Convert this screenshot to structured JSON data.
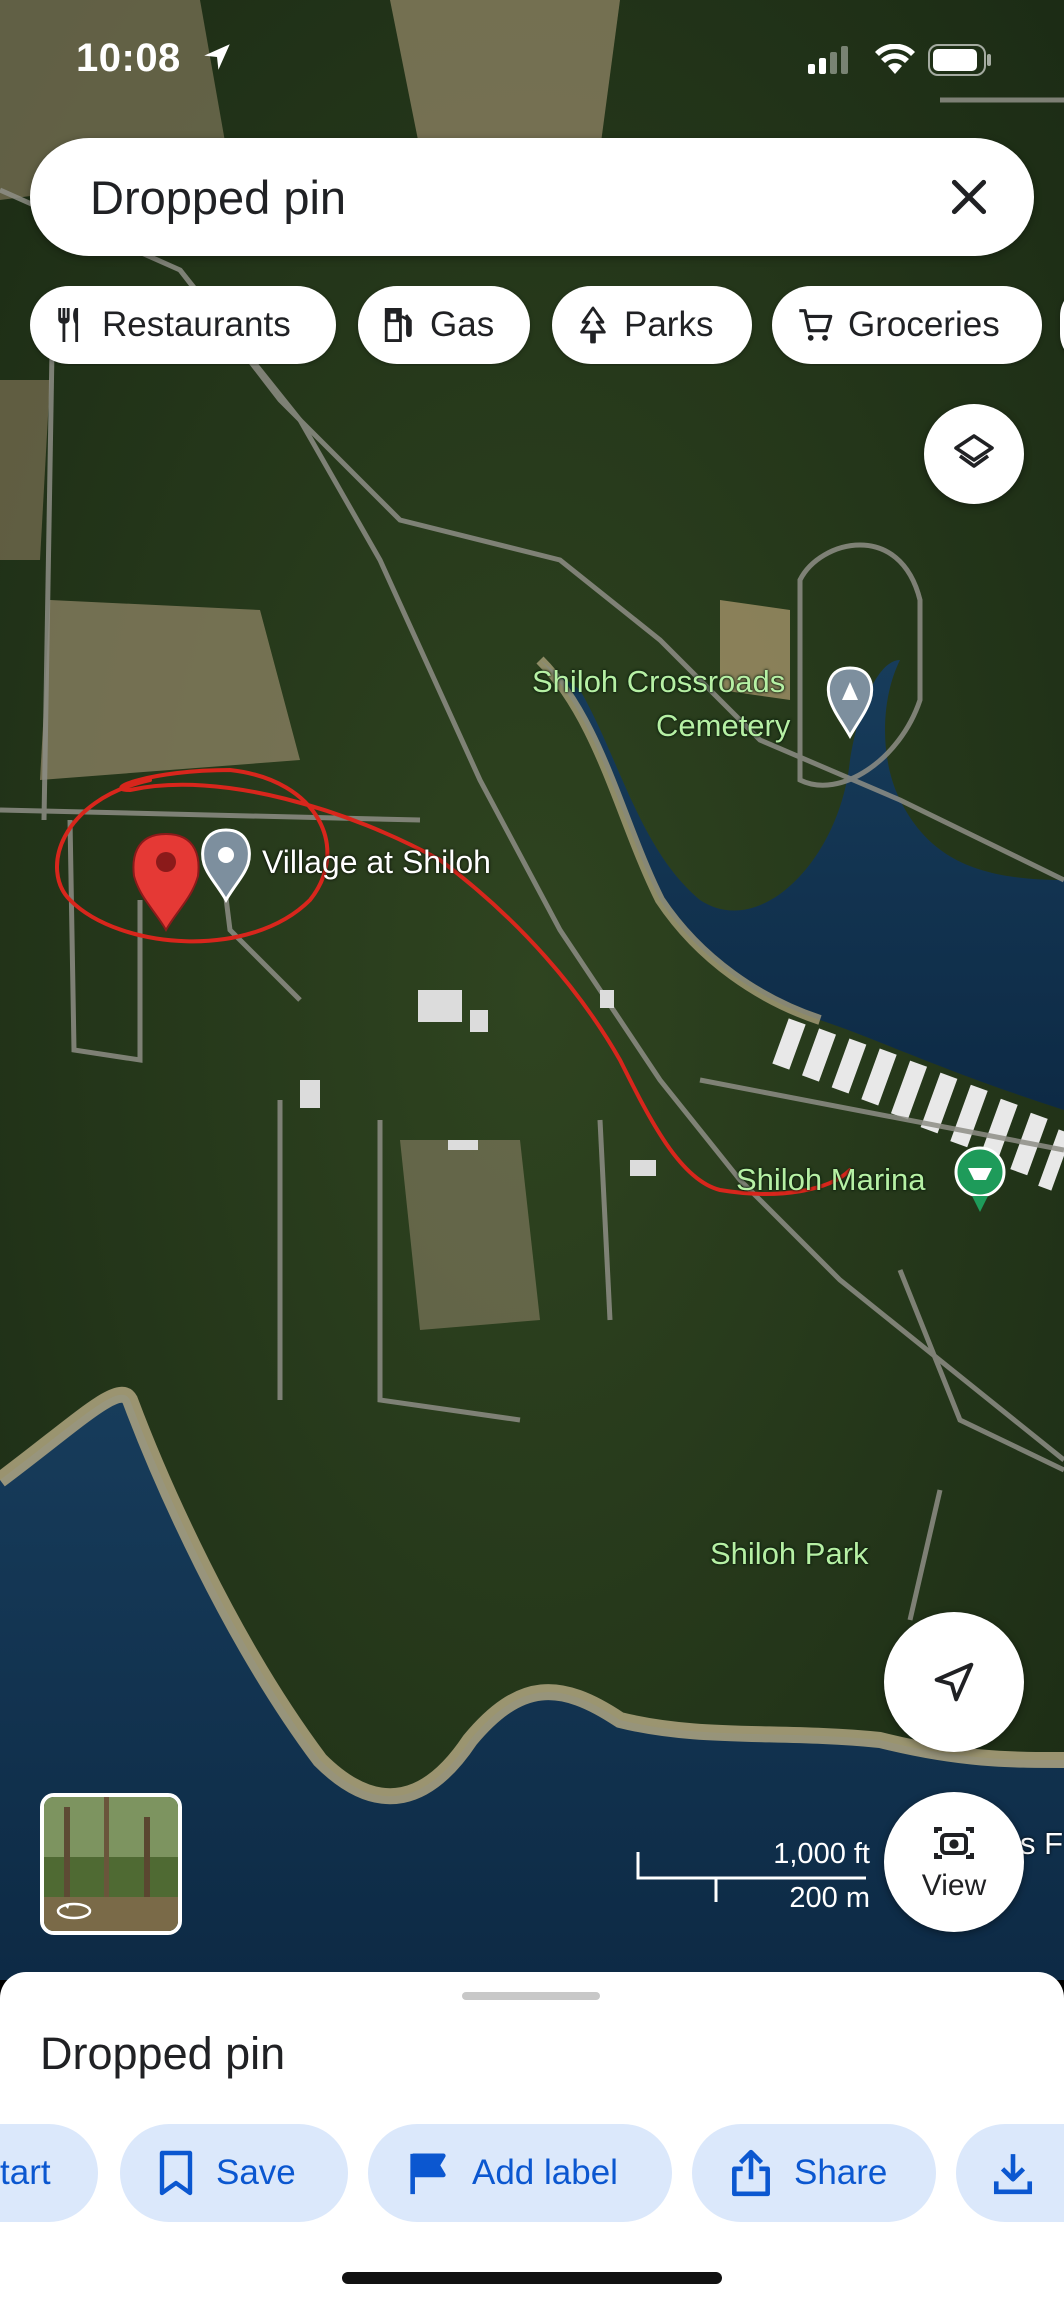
{
  "status_bar": {
    "time": "10:08",
    "icons": [
      "location-arrow-icon",
      "signal-icon",
      "wifi-icon",
      "battery-icon"
    ]
  },
  "search": {
    "query": "Dropped pin",
    "icon": "close-icon"
  },
  "chips": [
    {
      "label": "Restaurants",
      "icon": "fork-knife-icon"
    },
    {
      "label": "Gas",
      "icon": "gas-pump-icon"
    },
    {
      "label": "Parks",
      "icon": "tree-icon"
    },
    {
      "label": "Groceries",
      "icon": "cart-icon"
    }
  ],
  "map": {
    "labels": {
      "cemetery_1": "Shiloh Crossroads",
      "cemetery_2": "Cemetery",
      "village": "Village at Shiloh",
      "marina": "Shiloh Marina",
      "park": "Shiloh Park",
      "cutoff": "s F"
    },
    "scale": {
      "imperial": "1,000 ft",
      "metric": "200 m"
    },
    "view_button": "View"
  },
  "sheet": {
    "title": "Dropped pin",
    "actions": [
      {
        "label": "tart",
        "icon": ""
      },
      {
        "label": "Save",
        "icon": "bookmark-icon"
      },
      {
        "label": "Add label",
        "icon": "flag-icon"
      },
      {
        "label": "Share",
        "icon": "share-icon"
      },
      {
        "label": "",
        "icon": "download-icon"
      }
    ]
  },
  "colors": {
    "accent_blue": "#0b57d0",
    "chip_bg": "#dbe8fb",
    "pin_red": "#e53935",
    "annotation_red": "#d8261c",
    "map_label_green": "#b6f0a4"
  }
}
